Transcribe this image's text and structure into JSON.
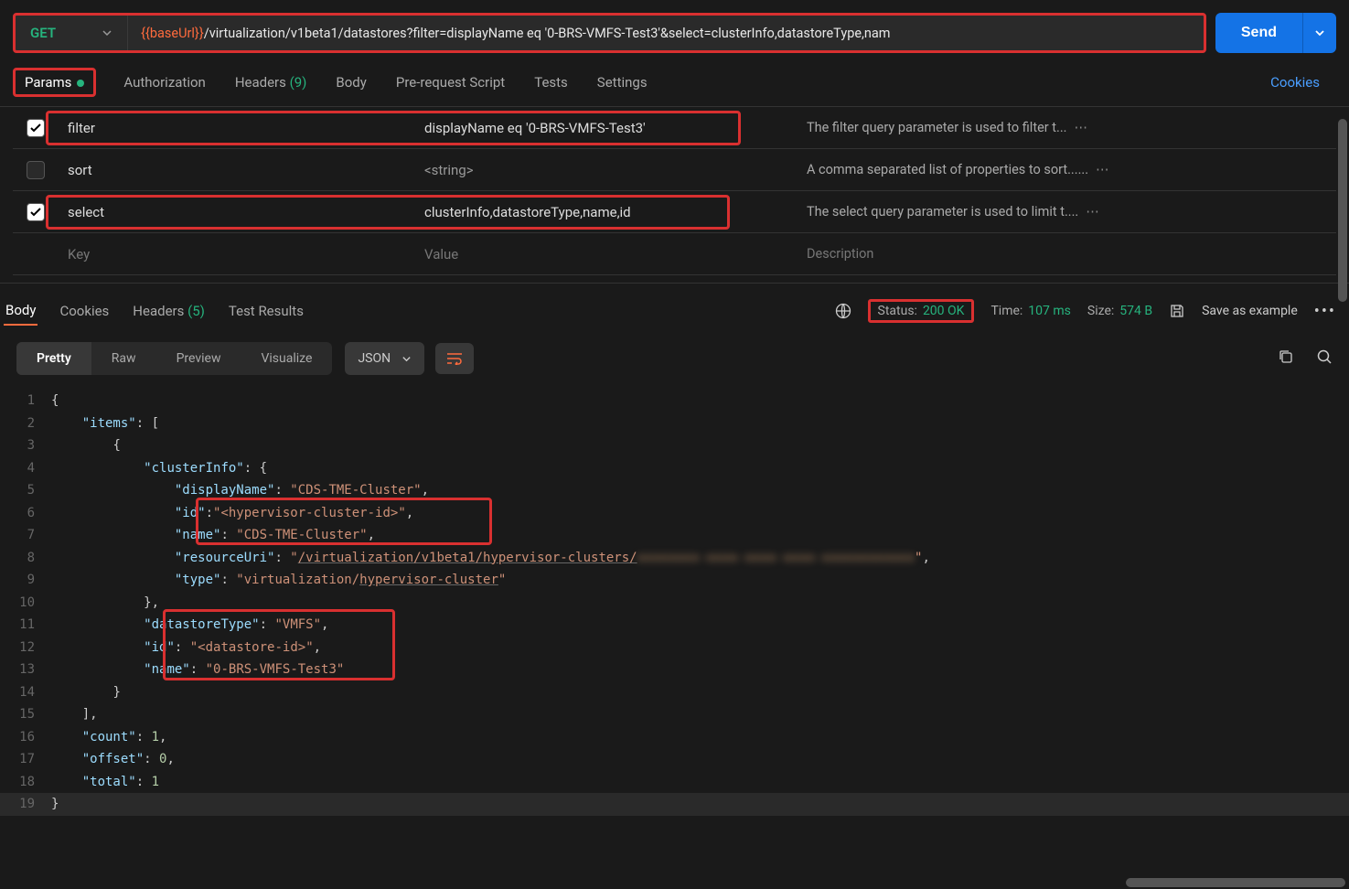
{
  "request": {
    "method": "GET",
    "url_var": "{{baseUrl}}",
    "url_path": "/virtualization/v1beta1/datastores?filter=displayName eq '0-BRS-VMFS-Test3'&select=clusterInfo,datastoreType,nam",
    "send_label": "Send"
  },
  "tabs": {
    "params": "Params",
    "authorization": "Authorization",
    "headers": "Headers",
    "headers_count": "(9)",
    "body": "Body",
    "prerequest": "Pre-request Script",
    "tests": "Tests",
    "settings": "Settings",
    "cookies": "Cookies"
  },
  "params": [
    {
      "checked": true,
      "key": "filter",
      "value": "displayName eq '0-BRS-VMFS-Test3'",
      "desc": "The filter query parameter is used to filter t...",
      "highlight": true
    },
    {
      "checked": false,
      "key": "sort",
      "value": "<string>",
      "desc": "A comma separated list of properties to sort......",
      "highlight": false,
      "placeholder_value": true
    },
    {
      "checked": true,
      "key": "select",
      "value": "clusterInfo,datastoreType,name,id",
      "desc": "The select query parameter is used to limit t....",
      "highlight": true
    }
  ],
  "param_placeholders": {
    "key": "Key",
    "value": "Value",
    "desc": "Description"
  },
  "response": {
    "tabs": {
      "body": "Body",
      "cookies": "Cookies",
      "headers": "Headers",
      "headers_count": "(5)",
      "test_results": "Test Results"
    },
    "status_label": "Status:",
    "status_value": "200 OK",
    "time_label": "Time:",
    "time_value": "107 ms",
    "size_label": "Size:",
    "size_value": "574 B",
    "save_example": "Save as example"
  },
  "body_controls": {
    "pretty": "Pretty",
    "raw": "Raw",
    "preview": "Preview",
    "visualize": "Visualize",
    "format": "JSON"
  },
  "json_body": {
    "items": [
      {
        "clusterInfo": {
          "displayName": "CDS-TME-Cluster",
          "id": "<hypervisor-cluster-id>",
          "name": "CDS-TME-Cluster",
          "resourceUri": "/virtualization/v1beta1/hypervisor-clusters/",
          "type": "virtualization/hypervisor-cluster"
        },
        "datastoreType": "VMFS",
        "id": "<datastore-id>",
        "name": "0-BRS-VMFS-Test3"
      }
    ],
    "count": 1,
    "offset": 0,
    "total": 1
  }
}
